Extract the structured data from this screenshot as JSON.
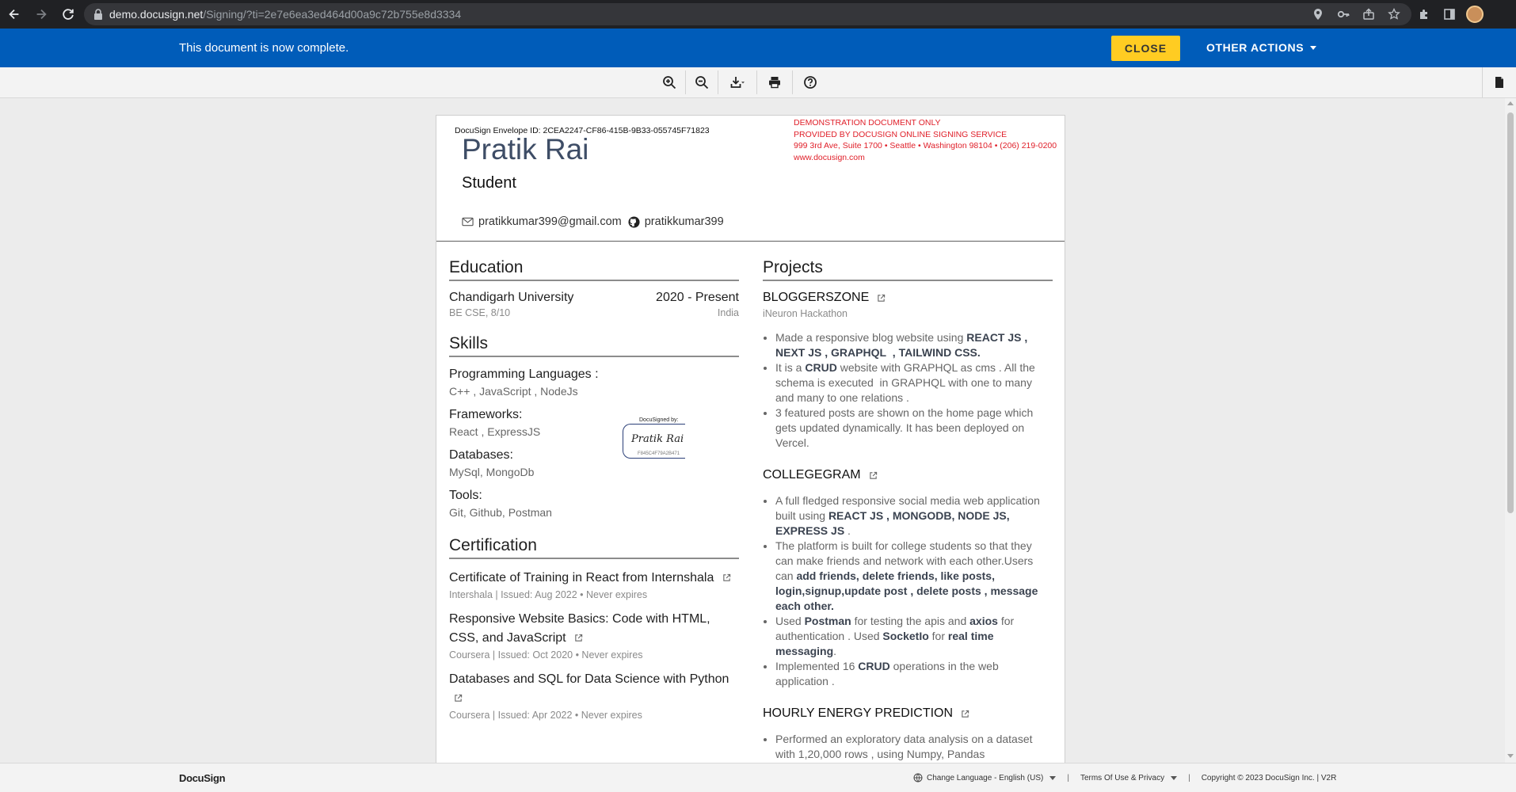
{
  "browser": {
    "url_host": "demo.docusign.net",
    "url_path": "/Signing/?ti=2e7e6ea3ed464d00a9c72b755e8d3334"
  },
  "notice": {
    "message": "This document is now complete.",
    "close_label": "CLOSE",
    "other_actions_label": "OTHER ACTIONS"
  },
  "document": {
    "envelope_id": "DocuSign Envelope ID: 2CEA2247-CF86-415B-9B33-055745F71823",
    "demo_lines": [
      "DEMONSTRATION DOCUMENT ONLY",
      "PROVIDED BY DOCUSIGN ONLINE SIGNING SERVICE",
      "999 3rd Ave, Suite 1700  • Seattle • Washington 98104 • (206) 219-0200",
      "www.docusign.com"
    ],
    "name": "Pratik Rai",
    "role": "Student",
    "email": "pratikkumar399@gmail.com",
    "github": "pratikkumar399",
    "education": {
      "title": "Education",
      "school": "Chandigarh University",
      "years": "2020 - Present",
      "degree": "BE CSE, 8/10",
      "location": "India"
    },
    "skills": {
      "title": "Skills",
      "groups": [
        {
          "heading": "Programming Languages :",
          "value": "C++ , JavaScript , NodeJs"
        },
        {
          "heading": "Frameworks:",
          "value": "React , ExpressJS"
        },
        {
          "heading": "Databases:",
          "value": "MySql, MongoDb"
        },
        {
          "heading": "Tools:",
          "value": "Git, Github, Postman"
        }
      ]
    },
    "signature": {
      "label": "DocuSigned by:",
      "name": "Pratik Rai",
      "id": "F845C4F79A2B471"
    },
    "certification": {
      "title": "Certification",
      "items": [
        {
          "title": "Certificate of Training in React from Internshala",
          "meta": "Intershala | Issued: Aug 2022 • Never expires"
        },
        {
          "title": "Responsive Website Basics: Code with HTML, CSS, and JavaScript",
          "meta": "Coursera | Issued: Oct 2020 • Never expires"
        },
        {
          "title": "Databases and SQL for Data Science with Python",
          "meta": "Coursera | Issued: Apr 2022 • Never expires"
        }
      ]
    },
    "projects": {
      "title": "Projects",
      "p1": {
        "title": "BLOGGERSZONE",
        "org": "iNeuron Hackathon"
      },
      "p2": {
        "title": "COLLEGEGRAM"
      },
      "p3": {
        "title": "HOURLY ENERGY PREDICTION"
      }
    }
  },
  "footer": {
    "brand": "DocuSign",
    "language": "Change Language - English (US)",
    "terms": "Terms Of Use & Privacy",
    "copyright": "Copyright © 2023 DocuSign Inc. | V2R"
  }
}
